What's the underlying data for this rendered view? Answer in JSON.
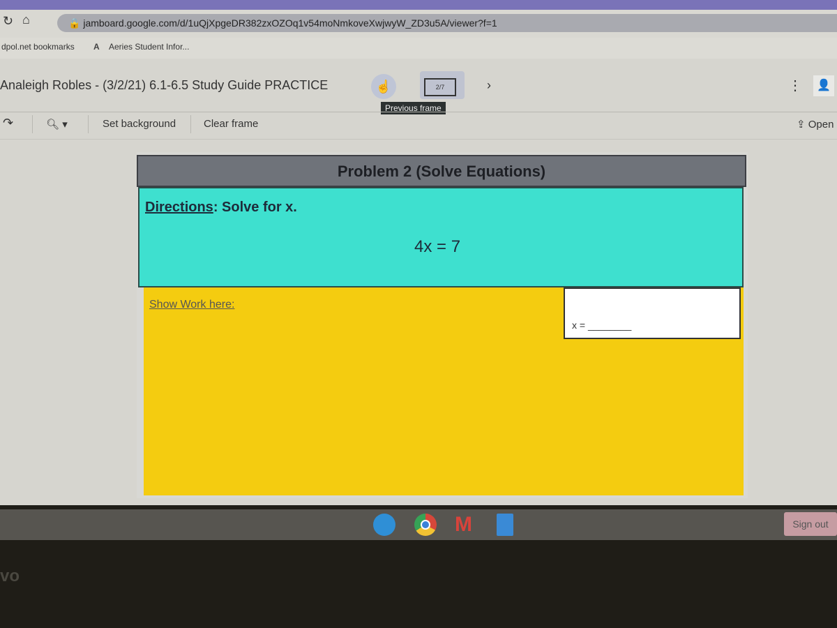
{
  "browser": {
    "url": "jamboard.google.com/d/1uQjXpgeDR382zxOZOq1v54moNmkoveXwjwyW_ZD3u5A/viewer?f=1",
    "bookmarks": [
      "dpol.net bookmarks",
      "Aeries Student Infor..."
    ]
  },
  "app": {
    "title": "Analeigh Robles - (3/2/21) 6.1-6.5 Study Guide PRACTICE",
    "frame_counter": "2/7",
    "tooltip": "Previous frame",
    "toolbar": {
      "set_background": "Set background",
      "clear_frame": "Clear frame",
      "open": "Open"
    }
  },
  "frame": {
    "header": "Problem 2 (Solve Equations)",
    "directions_label": "Directions",
    "directions_text": ": Solve for x.",
    "equation": "4x = 7",
    "show_work": "Show Work here:",
    "answer_label": "x = ________"
  },
  "shelf": {
    "apps": [
      "zoom-icon",
      "chrome-icon",
      "gmail-icon",
      "docs-icon"
    ],
    "sign_out": "Sign out"
  },
  "bezel": {
    "brand": "vo"
  }
}
